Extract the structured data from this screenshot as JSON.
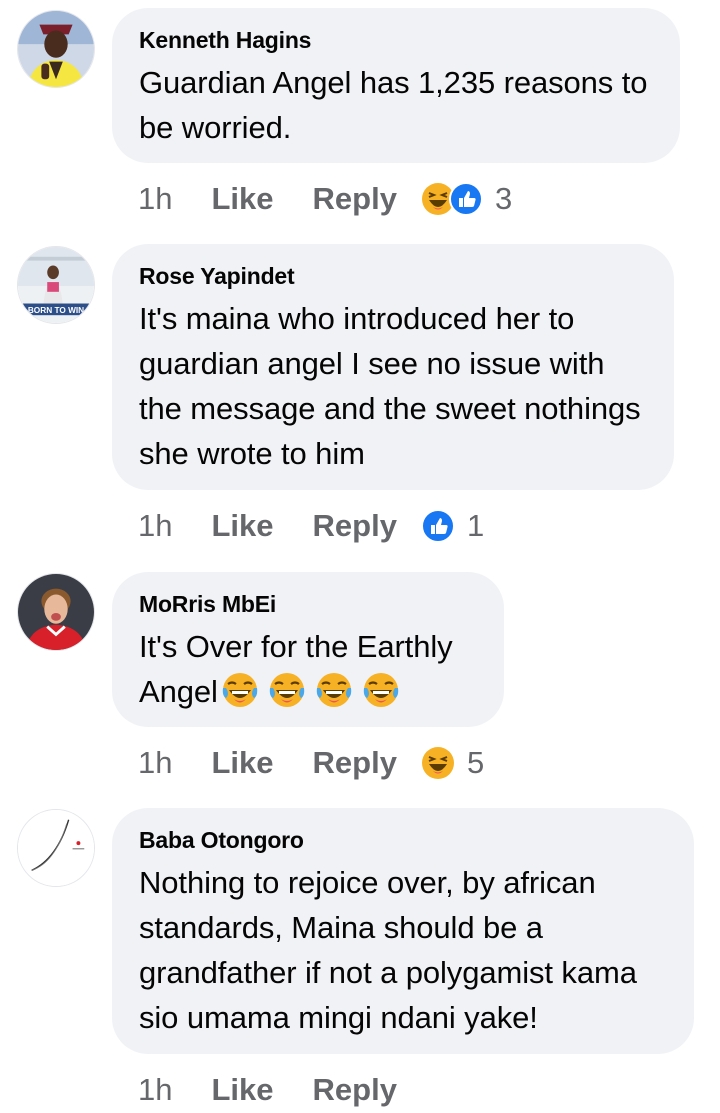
{
  "comments": [
    {
      "author": "Kenneth Hagins",
      "text": "Guardian Angel has 1,235 reasons to be worried.",
      "time": "1h",
      "like_label": "Like",
      "reply_label": "Reply",
      "reactions": [
        "haha",
        "like"
      ],
      "reaction_count": "3"
    },
    {
      "author": "Rose Yapindet",
      "text": "It's maina who introduced her to guardian angel I see no issue with the message and the sweet nothings she wrote to him",
      "avatar_caption": "BORN TO WIN",
      "time": "1h",
      "like_label": "Like",
      "reply_label": "Reply",
      "reactions": [
        "like"
      ],
      "reaction_count": "1"
    },
    {
      "author": "MoRris MbEi",
      "text_line1": "It's Over for the Earthly",
      "text_line2": "Angel",
      "text_emojis": [
        "tears-of-joy",
        "tears-of-joy",
        "tears-of-joy",
        "tears-of-joy"
      ],
      "time": "1h",
      "like_label": "Like",
      "reply_label": "Reply",
      "reactions": [
        "haha"
      ],
      "reaction_count": "5"
    },
    {
      "author": "Baba Otongoro",
      "text": "Nothing to rejoice over, by african standards, Maina should be a grandfather if not a polygamist kama sio umama mingi ndani yake!",
      "time": "1h",
      "like_label": "Like",
      "reply_label": "Reply"
    }
  ],
  "colors": {
    "bubble": "#f0f2f5",
    "meta_text": "#65676b",
    "like_blue": "#1877f2",
    "haha_yellow": "#f7b125"
  }
}
